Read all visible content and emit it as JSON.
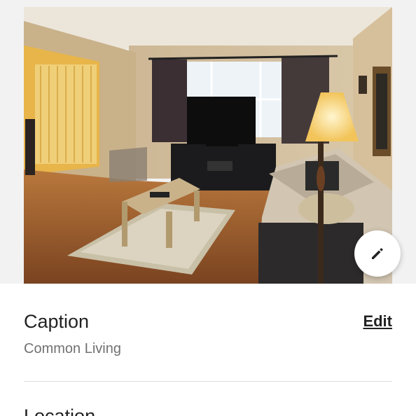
{
  "photo": {
    "subject": "living room photo",
    "edit_icon": "pencil-icon"
  },
  "caption": {
    "label": "Caption",
    "edit_label": "Edit",
    "value": "Common Living"
  },
  "location": {
    "label": "Location"
  },
  "colors": {
    "text_primary": "#222222",
    "text_secondary": "#717171",
    "divider": "#dddddd",
    "background": "#ffffff"
  }
}
